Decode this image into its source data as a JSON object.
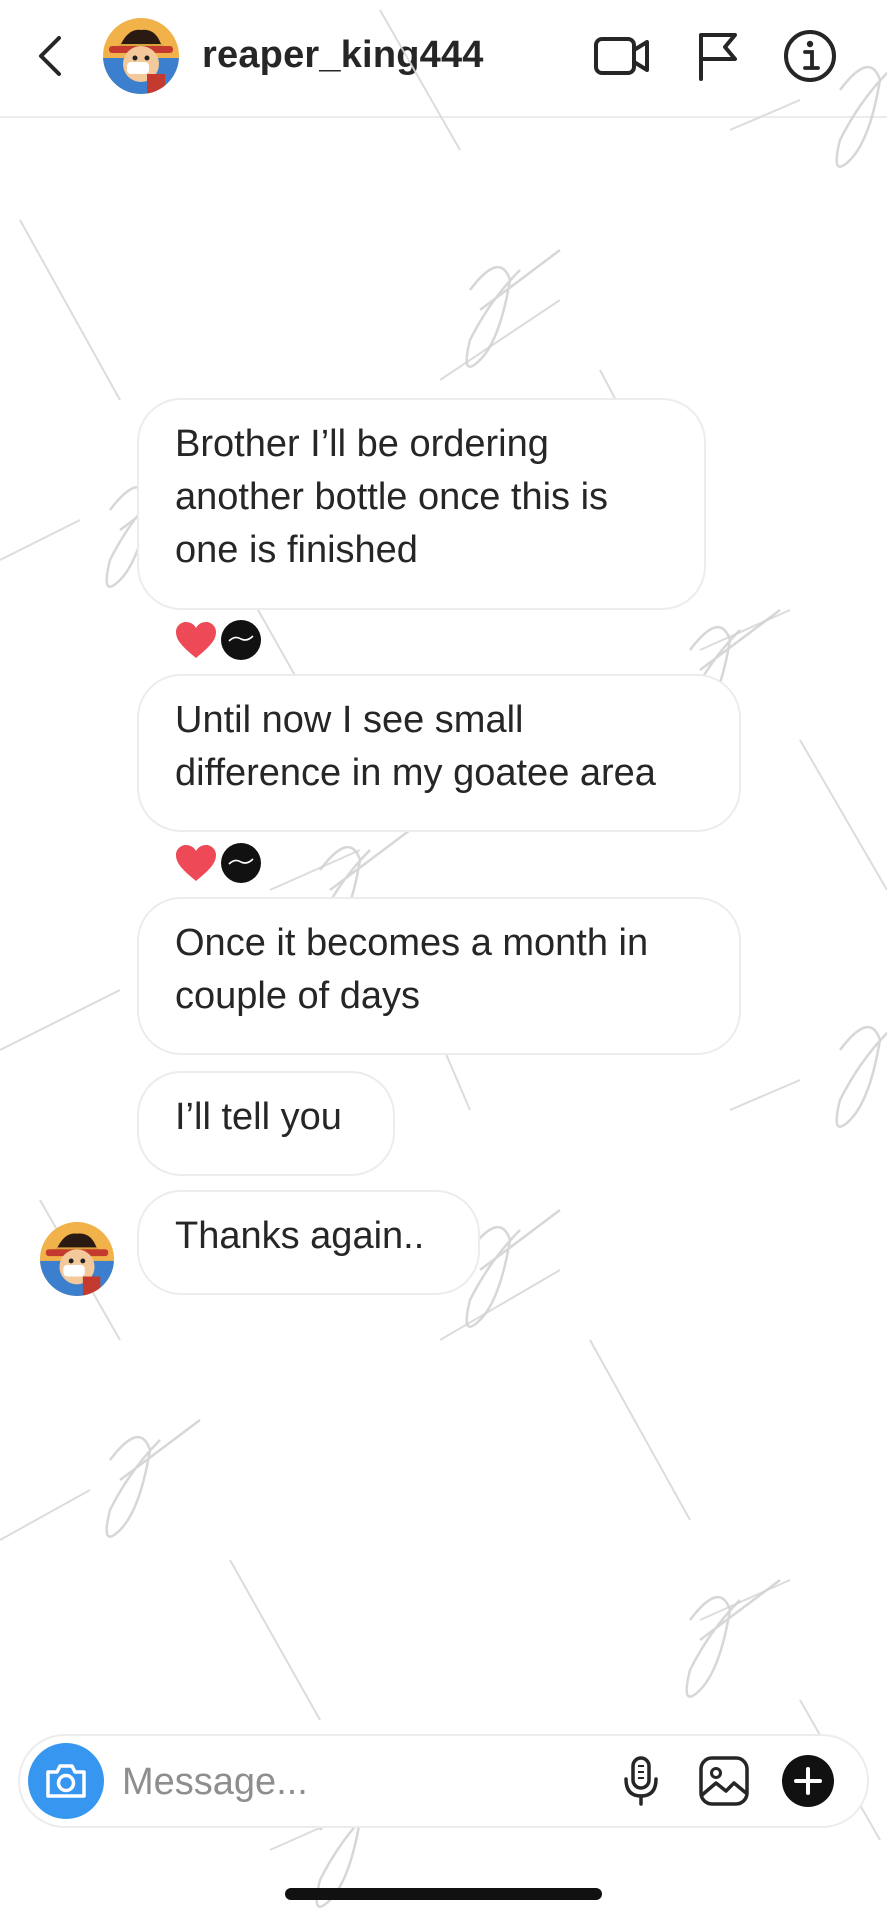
{
  "header": {
    "username": "reaper_king444",
    "icons": [
      "back-chevron-icon",
      "video-camera-icon",
      "flag-icon",
      "info-icon"
    ]
  },
  "messages": [
    {
      "lines": [
        "Brother I’ll be ordering",
        "another bottle once this is",
        "one is finished"
      ]
    },
    {
      "lines": [
        "Until now I see small",
        "difference in my goatee area"
      ]
    },
    {
      "lines": [
        "Once it becomes a month in",
        "couple of days"
      ]
    },
    {
      "lines": [
        "I’ll tell you"
      ]
    },
    {
      "lines": [
        "Thanks again.."
      ]
    }
  ],
  "reactions": [
    {
      "after_message": 1,
      "items": [
        "heart-icon",
        "reactor-avatar"
      ]
    },
    {
      "after_message": 2,
      "items": [
        "heart-icon",
        "reactor-avatar"
      ]
    }
  ],
  "composer": {
    "placeholder": "Message...",
    "icons": [
      "camera-icon",
      "microphone-icon",
      "gallery-icon",
      "plus-icon"
    ]
  },
  "colors": {
    "accent": "#3797f0",
    "heart": "#ed4956",
    "bubble_border": "#ececec",
    "text": "#262626",
    "placeholder": "#8e8e8e"
  }
}
